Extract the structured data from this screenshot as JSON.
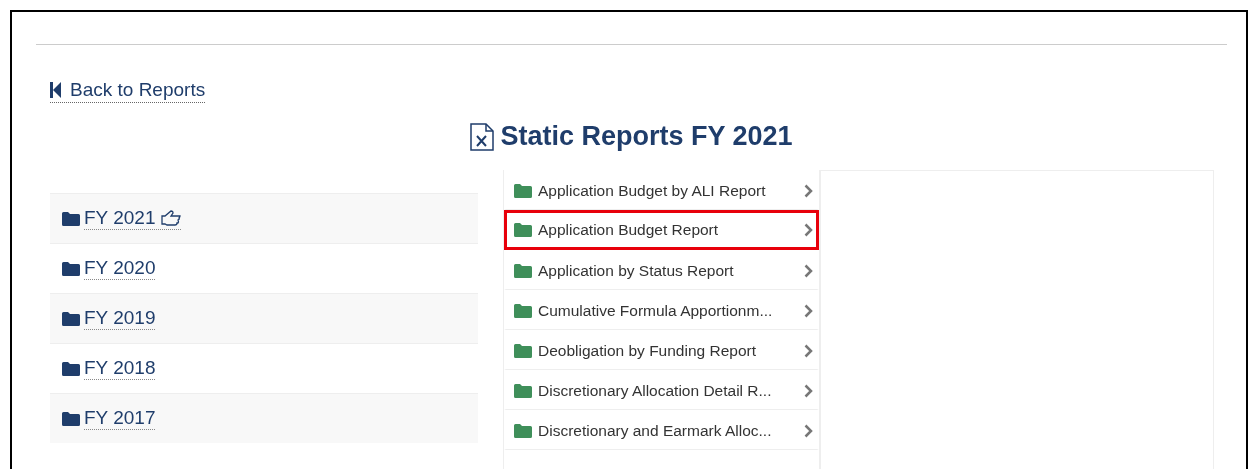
{
  "back_link": "Back to Reports",
  "title": "Static Reports FY 2021",
  "years": [
    {
      "label": "FY 2021",
      "selected": true
    },
    {
      "label": "FY 2020",
      "selected": false
    },
    {
      "label": "FY 2019",
      "selected": false
    },
    {
      "label": "FY 2018",
      "selected": false
    },
    {
      "label": "FY 2017",
      "selected": false
    }
  ],
  "reports": [
    {
      "label": "Application Budget by ALI Report",
      "selected": false
    },
    {
      "label": "Application Budget Report",
      "selected": true
    },
    {
      "label": "Application by Status Report",
      "selected": false
    },
    {
      "label": "Cumulative Formula Apportionm...",
      "selected": false
    },
    {
      "label": "Deobligation by Funding Report",
      "selected": false
    },
    {
      "label": "Discretionary Allocation Detail R...",
      "selected": false
    },
    {
      "label": "Discretionary and Earmark Alloc...",
      "selected": false
    }
  ]
}
